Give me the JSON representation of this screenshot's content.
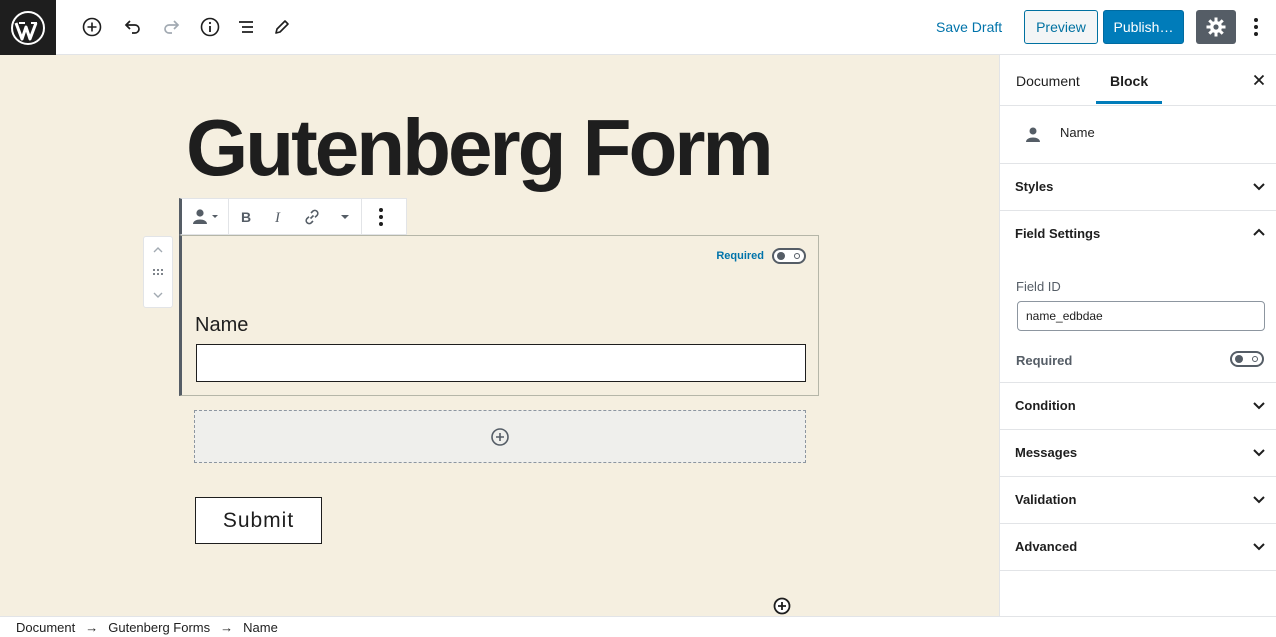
{
  "toolbar": {
    "save_draft": "Save Draft",
    "preview": "Preview",
    "publish": "Publish…",
    "accent": "#007cba"
  },
  "post": {
    "title": "Gutenberg Form"
  },
  "field": {
    "required_label": "Required",
    "label": "Name"
  },
  "submit_label": "Submit",
  "breadcrumb": [
    "Document",
    "Gutenberg Forms",
    "Name"
  ],
  "sidebar": {
    "tabs": [
      "Document",
      "Block"
    ],
    "active_tab": "Block",
    "block_name": "Name",
    "panels": {
      "styles": "Styles",
      "field_settings": "Field Settings",
      "condition": "Condition",
      "messages": "Messages",
      "validation": "Validation",
      "advanced": "Advanced"
    },
    "field_id_label": "Field ID",
    "field_id_value": "name_edbdae",
    "required_label": "Required"
  }
}
